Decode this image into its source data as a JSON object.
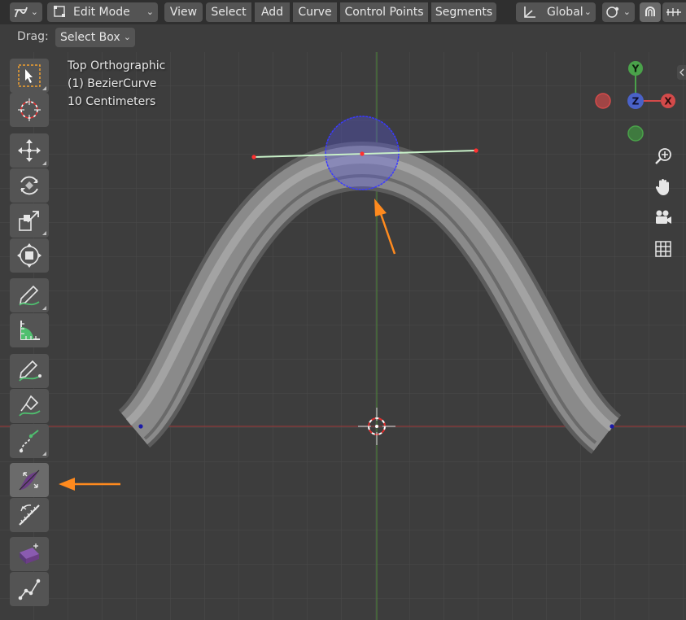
{
  "header": {
    "mode_label": "Edit Mode",
    "menus": [
      "View",
      "Select",
      "Add",
      "Curve",
      "Control Points",
      "Segments"
    ],
    "orientation_label": "Global"
  },
  "toolbar_settings": {
    "drag_label": "Drag:",
    "drag_value": "Select Box"
  },
  "overlay": {
    "view_name": "Top Orthographic",
    "object_name": "(1) BezierCurve",
    "scale": "10 Centimeters"
  },
  "gizmo": {
    "y_label": "Y",
    "z_label": "Z",
    "x_label": "X"
  },
  "tools": [
    "select-box",
    "cursor",
    "move",
    "rotate",
    "scale",
    "transform",
    "annotate",
    "measure",
    "draw",
    "pen",
    "extrude-cursor",
    "radius",
    "tilt",
    "randomize",
    "vertex-randomize"
  ],
  "icons": {
    "editor_type": "curve-editor-icon",
    "mode": "edit-mode-icon",
    "orientation": "transform-orientation-icon",
    "pivot": "pivot-point-icon",
    "snap": "magnet-snap-icon",
    "proportional": "proportional-edit-icon",
    "nav": [
      "zoom-icon",
      "hand-pan-icon",
      "camera-icon",
      "grid-icon"
    ]
  },
  "colors": {
    "viewport_bg": "#3d3d3d",
    "grid_line": "#4a4a4a",
    "x_axis": "#8e3b3b",
    "y_axis": "#4d7d3b",
    "curve_body": "#8a8a8a",
    "selection_circle": "#3a3aff",
    "handle_line": "#c8f0c8",
    "handle_point": "#ff3030",
    "accent_arrow": "#ff8a1e",
    "gizmo_x": "#d44a4a",
    "gizmo_y": "#4aa24a",
    "gizmo_z": "#4a62c8",
    "active_tool_icon": "#6b3d85"
  }
}
